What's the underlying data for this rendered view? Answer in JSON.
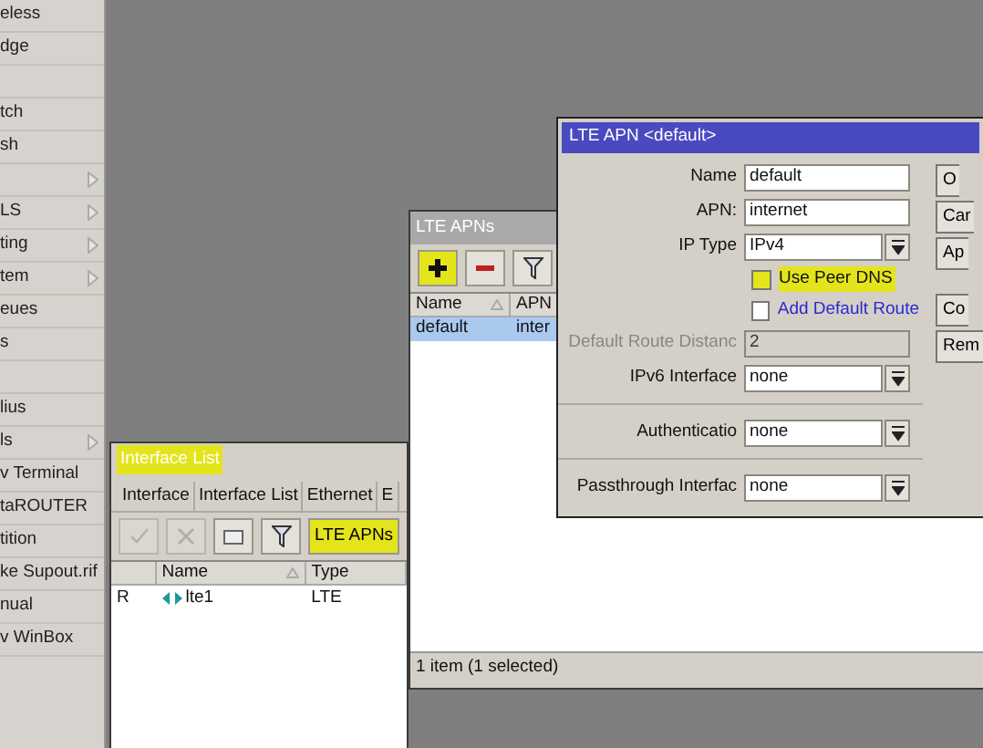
{
  "sidebar": {
    "items": [
      {
        "label": "eless",
        "submenu": false
      },
      {
        "label": "dge",
        "submenu": false
      },
      {
        "submenu": false
      },
      {
        "label": "tch",
        "submenu": false
      },
      {
        "label": "sh",
        "submenu": false
      },
      {
        "submenu": true
      },
      {
        "label": "LS",
        "submenu": true
      },
      {
        "label": "ting",
        "submenu": true
      },
      {
        "label": "tem",
        "submenu": true
      },
      {
        "label": "eues",
        "submenu": false
      },
      {
        "label": "s",
        "submenu": false
      },
      {
        "submenu": false
      },
      {
        "label": "lius",
        "submenu": false
      },
      {
        "label": "ls",
        "submenu": true
      },
      {
        "label": "v Terminal",
        "submenu": false
      },
      {
        "label": "taROUTER",
        "submenu": false
      },
      {
        "label": "tition",
        "submenu": false
      },
      {
        "label": "ke Supout.rif",
        "submenu": false
      },
      {
        "label": "nual",
        "submenu": false
      },
      {
        "label": "v WinBox",
        "submenu": false
      }
    ]
  },
  "interface_list": {
    "title": "Interface List",
    "highlighted": true,
    "tabs": [
      "Interface",
      "Interface List",
      "Ethernet",
      "E"
    ],
    "toolbar": [
      {
        "kind": "enable",
        "disabled": true,
        "highlighted": false
      },
      {
        "kind": "disable",
        "disabled": true,
        "highlighted": false
      },
      {
        "kind": "comment",
        "disabled": false,
        "highlighted": false
      },
      {
        "kind": "filter",
        "disabled": false,
        "highlighted": false
      },
      {
        "kind": "text",
        "label": "LTE APNs",
        "disabled": false,
        "highlighted": true
      }
    ],
    "columns": [
      "",
      "Name",
      "Type"
    ],
    "rows": [
      {
        "cells": [
          "R",
          "lte1",
          "LTE"
        ],
        "selected": false
      }
    ]
  },
  "lte_apns": {
    "title": "LTE APNs",
    "toolbar": [
      {
        "kind": "add",
        "highlighted": true
      },
      {
        "kind": "remove",
        "highlighted": false
      },
      {
        "kind": "filter",
        "highlighted": false
      }
    ],
    "columns": [
      "Name",
      "APN"
    ],
    "rows": [
      {
        "cells": [
          "default",
          "inter"
        ],
        "selected": true
      }
    ],
    "status": "1 item (1 selected)"
  },
  "dialog": {
    "title": "LTE APN <default>",
    "field_groups": [
      [
        {
          "kind": "text",
          "label": "Name",
          "value": "default",
          "disabled": false
        },
        {
          "kind": "text",
          "label": "APN:",
          "value": "internet",
          "disabled": false
        },
        {
          "kind": "select",
          "label": "IP Type",
          "value": "IPv4",
          "disabled": false
        },
        {
          "kind": "checkbox",
          "label": "Use Peer DNS",
          "checked": false,
          "highlighted": true,
          "accent": false
        },
        {
          "kind": "checkbox",
          "label": "Add Default Route",
          "checked": false,
          "highlighted": false,
          "accent": true
        },
        {
          "kind": "text",
          "label": "Default Route Distanc",
          "value": "2",
          "disabled": true
        },
        {
          "kind": "select",
          "label": "IPv6 Interface",
          "value": "none",
          "disabled": false
        }
      ],
      [
        {
          "kind": "select",
          "label": "Authenticatio",
          "value": "none",
          "disabled": false
        }
      ],
      [
        {
          "kind": "select",
          "label": "Passthrough Interfac",
          "value": "none",
          "disabled": false
        }
      ]
    ],
    "button_groups": [
      [
        "O",
        "Car",
        "Ap"
      ],
      [
        "Co",
        "Rem"
      ]
    ]
  }
}
